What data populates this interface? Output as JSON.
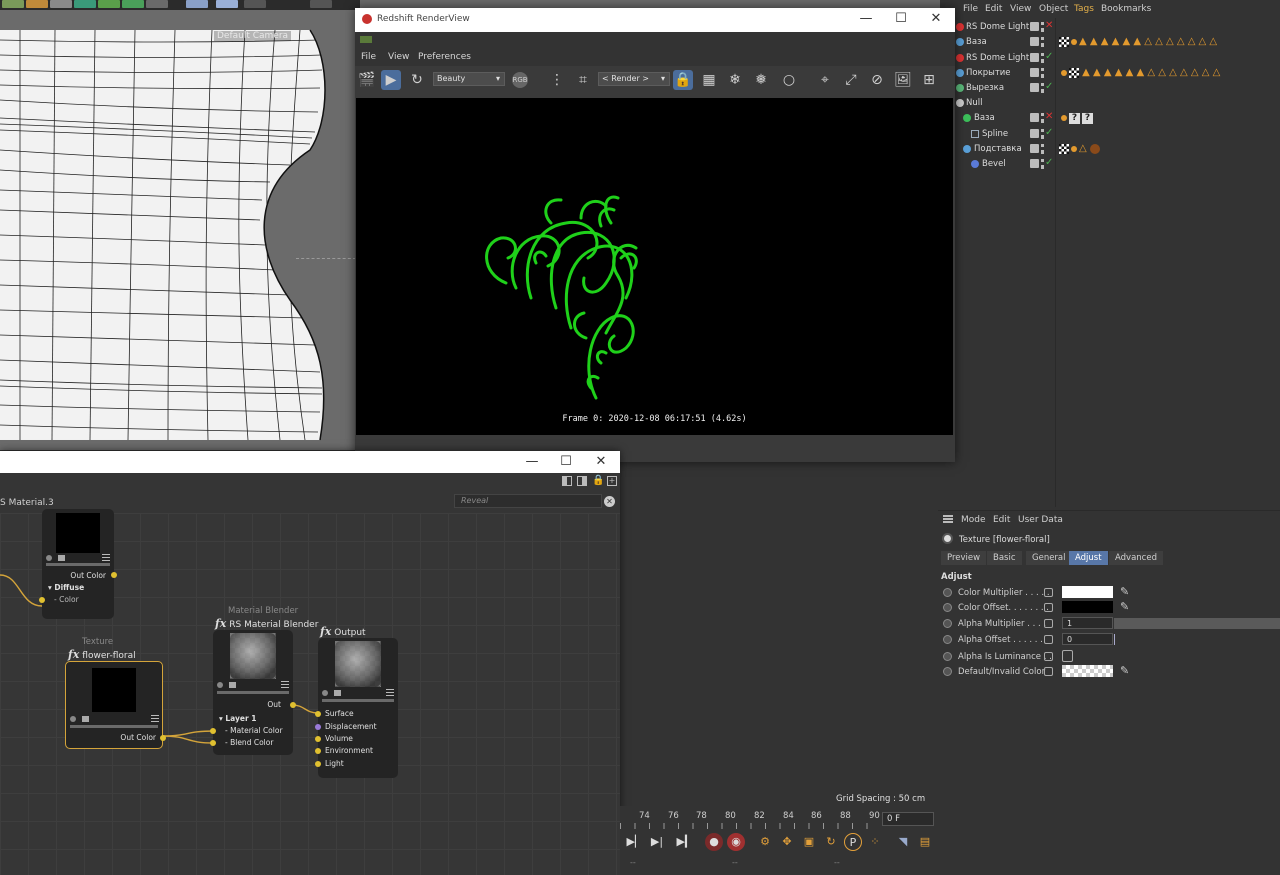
{
  "viewport": {
    "camera_label": "Default Camera"
  },
  "render_view": {
    "title": "Redshift RenderView",
    "menu": [
      "File",
      "View",
      "Preferences"
    ],
    "aov_select": "Beauty",
    "render_select": "< Render >",
    "rgb_label": "RGB",
    "frame_info": "Frame 0: 2020-12-08 06:17:51 (4.62s)"
  },
  "object_manager": {
    "menu": [
      "File",
      "Edit",
      "View",
      "Object",
      "Tags",
      "Bookmarks"
    ],
    "objects": [
      {
        "name": "RS Dome Light",
        "icon": "dome-light-icon",
        "status": "off"
      },
      {
        "name": "Ваза",
        "icon": "object-icon",
        "status": "on"
      },
      {
        "name": "RS Dome Light",
        "icon": "dome-light-icon",
        "status": "on"
      },
      {
        "name": "Покрытие",
        "icon": "object-icon",
        "status": "on"
      },
      {
        "name": "Вырезка",
        "icon": "object-icon",
        "status": "on"
      },
      {
        "name": "Null",
        "icon": "null-icon",
        "status": "none"
      },
      {
        "name": "Ваза",
        "icon": "object-icon",
        "status": "off"
      },
      {
        "name": "Spline",
        "icon": "spline-icon",
        "status": "on"
      },
      {
        "name": "Подставка",
        "icon": "object-icon",
        "status": "on"
      },
      {
        "name": "Bevel",
        "icon": "bevel-icon",
        "status": "on"
      }
    ]
  },
  "attribute_manager": {
    "menu": [
      "Mode",
      "Edit",
      "User Data"
    ],
    "object_title": "Texture [flower-floral]",
    "tabs": [
      "Preview",
      "Basic",
      "General",
      "Adjust",
      "Advanced"
    ],
    "active_tab": "Adjust",
    "section": "Adjust",
    "params": [
      {
        "label": "Color Multiplier . . . . .",
        "kind": "color",
        "value": "",
        "color": "#ffffff"
      },
      {
        "label": "Color Offset. . . . . . . .",
        "kind": "color",
        "value": "",
        "color": "#000000"
      },
      {
        "label": "Alpha Multiplier . . . .",
        "kind": "number",
        "value": "1"
      },
      {
        "label": "Alpha Offset  . . . . . .",
        "kind": "number",
        "value": "0"
      },
      {
        "label": "Alpha Is Luminance . .",
        "kind": "checkbox",
        "value": ""
      },
      {
        "label": "Default/Invalid Color",
        "kind": "checker",
        "value": ""
      }
    ]
  },
  "node_editor": {
    "breadcrumb": "S Material.3",
    "search_placeholder": "Reveal",
    "nodes": {
      "material": {
        "out_port": "Out Color",
        "section": "Diffuse",
        "in_port": "Color"
      },
      "texture": {
        "type": "Texture",
        "name": "flower-floral",
        "out_port": "Out Color"
      },
      "blender": {
        "type": "Material Blender",
        "name": "RS Material Blender",
        "out_port": "Out",
        "section": "Layer 1",
        "in_ports": [
          "Material Color",
          "Blend Color"
        ]
      },
      "output": {
        "name": "Output",
        "in_ports": [
          "Surface",
          "Displacement",
          "Volume",
          "Environment",
          "Light"
        ]
      }
    }
  },
  "timeline": {
    "grid_spacing": "Grid Spacing : 50 cm",
    "ticks": [
      "74",
      "76",
      "78",
      "80",
      "82",
      "84",
      "86",
      "88",
      "90"
    ],
    "current_frame": "0 F"
  },
  "colors": {
    "accent": "#5877a8",
    "selection": "#d4a43a",
    "render_stroke": "#1fd11a"
  }
}
